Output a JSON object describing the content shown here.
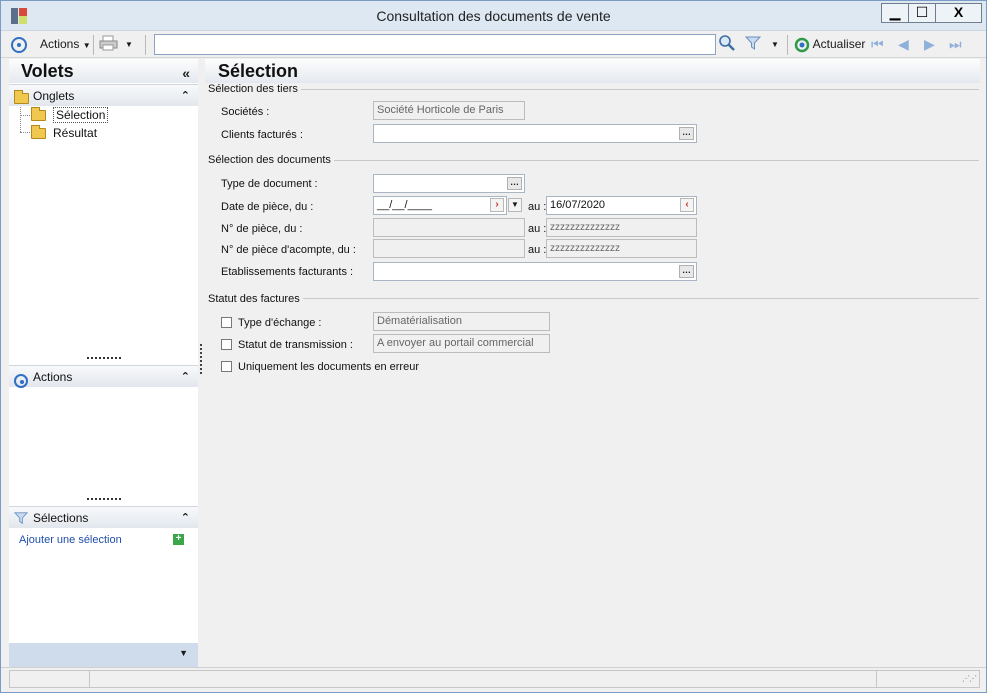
{
  "window": {
    "title": "Consultation des documents de vente",
    "minimize_glyph": "▁",
    "maximize_glyph": "☐",
    "close_glyph": "X"
  },
  "toolbar": {
    "actions_label": "Actions",
    "search_value": "",
    "refresh_label": "Actualiser"
  },
  "left_panel": {
    "title": "Volets",
    "collapse_glyph": "«",
    "tabs_section": {
      "label": "Onglets",
      "items": [
        {
          "label": "Sélection",
          "selected": true
        },
        {
          "label": "Résultat",
          "selected": false
        }
      ]
    },
    "actions_section": {
      "label": "Actions"
    },
    "selections_section": {
      "label": "Sélections",
      "add_link": "Ajouter une sélection"
    }
  },
  "main": {
    "title": "Sélection",
    "tiers_group": {
      "label": "Sélection des tiers",
      "societes_label": "Sociétés :",
      "societes_value": "Société Horticole de Paris",
      "clients_label": "Clients facturés :",
      "clients_value": ""
    },
    "documents_group": {
      "label": "Sélection des documents",
      "type_label": "Type de document :",
      "type_value": "",
      "date_label": "Date de pièce, du :",
      "date_from": "__/__/____",
      "date_to": "16/07/2020",
      "piece_label": "N° de pièce, du :",
      "piece_from": "",
      "piece_to": "zzzzzzzzzzzzzz",
      "acompte_label": "N° de pièce d'acompte, du :",
      "acompte_from": "",
      "acompte_to": "zzzzzzzzzzzzzz",
      "etab_label": "Etablissements facturants :",
      "etab_value": "",
      "au_label": "au :"
    },
    "status_group": {
      "label": "Statut des factures",
      "exchange_label": "Type d'échange :",
      "exchange_value": "Dématérialisation",
      "transmission_label": "Statut de transmission :",
      "transmission_value": "A envoyer au portail commercial",
      "errors_label": "Uniquement les documents en erreur"
    }
  },
  "colors": {
    "accent": "#2f6fc4",
    "title_bar": "#dde8f3",
    "link": "#1f4fa8"
  }
}
